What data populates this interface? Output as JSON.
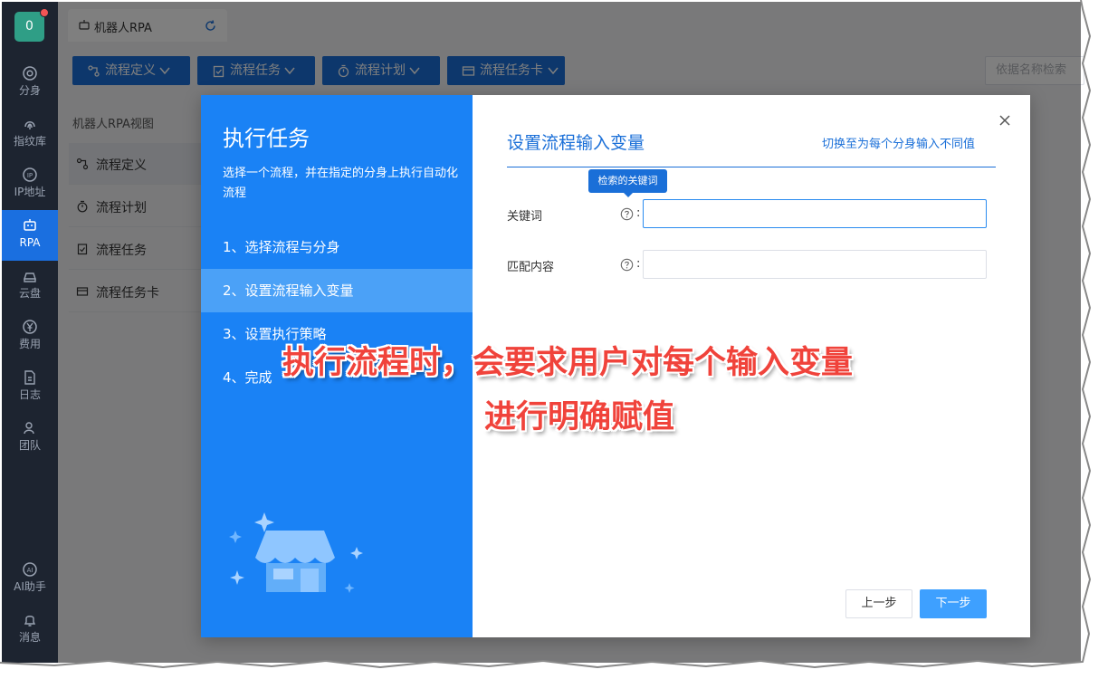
{
  "sidebar": {
    "badge_count": "0",
    "items": [
      {
        "label": "分身",
        "icon": "chrome-icon"
      },
      {
        "label": "指纹库",
        "icon": "fingerprint-icon"
      },
      {
        "label": "IP地址",
        "icon": "ip-icon"
      },
      {
        "label": "RPA",
        "icon": "robot-icon",
        "active": true
      },
      {
        "label": "云盘",
        "icon": "cloud-drive-icon"
      },
      {
        "label": "费用",
        "icon": "yen-icon"
      },
      {
        "label": "日志",
        "icon": "log-icon"
      },
      {
        "label": "团队",
        "icon": "team-icon"
      },
      {
        "label": "AI助手",
        "icon": "ai-icon"
      },
      {
        "label": "消息",
        "icon": "bell-icon"
      }
    ]
  },
  "tab": {
    "label": "机器人RPA"
  },
  "toolbar": {
    "flow_def": "流程定义",
    "flow_task": "流程任务",
    "flow_plan": "流程计划",
    "flow_card": "流程任务卡",
    "search_placeholder": "依据名称检索"
  },
  "left_panel": {
    "title": "机器人RPA视图",
    "menu": [
      "流程定义",
      "流程计划",
      "流程任务",
      "流程任务卡"
    ]
  },
  "dialog": {
    "title": "执行任务",
    "description": "选择一个流程，并在指定的分身上执行自动化流程",
    "steps": [
      "1、选择流程与分身",
      "2、设置流程输入变量",
      "3、设置执行策略",
      "4、完成"
    ],
    "section_title": "设置流程输入变量",
    "switch_link": "切换至为每个分身输入不同值",
    "tooltip": "检索的关键词",
    "fields": [
      {
        "label": "关键词",
        "value": ""
      },
      {
        "label": "匹配内容",
        "value": ""
      }
    ],
    "prev_button": "上一步",
    "next_button": "下一步"
  },
  "annotation": {
    "line1": "执行流程时，会要求用户对每个输入变量",
    "line2": "进行明确赋值"
  },
  "colors": {
    "primary": "#1a6fd8",
    "dialog_left": "#1a82f5",
    "annotation": "#f0433b",
    "sidebar": "#1d2430"
  }
}
